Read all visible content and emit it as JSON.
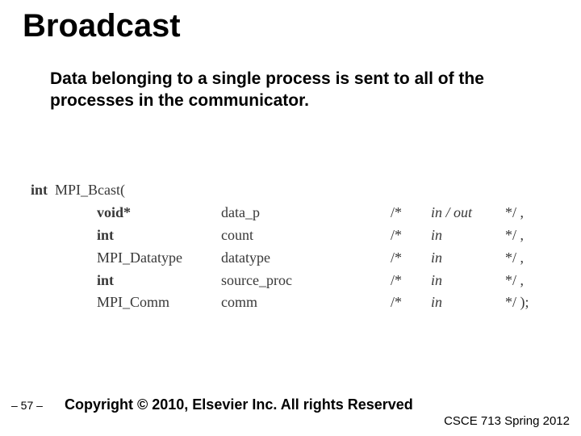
{
  "title": "Broadcast",
  "description": "Data belonging to a single process is sent to all of the processes in the communicator.",
  "code": {
    "ret": "int",
    "fn": "MPI_Bcast(",
    "params": [
      {
        "type": "void*",
        "type_bold": true,
        "name": "data_p",
        "dir": "in / out",
        "end": "*/ ,"
      },
      {
        "type": "int",
        "type_bold": true,
        "name": "count",
        "dir": "in",
        "end": "*/ ,"
      },
      {
        "type": "MPI_Datatype",
        "type_bold": false,
        "name": "datatype",
        "dir": "in",
        "end": "*/ ,"
      },
      {
        "type": "int",
        "type_bold": true,
        "name": "source_proc",
        "dir": "in",
        "end": "*/ ,"
      },
      {
        "type": "MPI_Comm",
        "type_bold": false,
        "name": "comm",
        "dir": "in",
        "end": "*/ );"
      }
    ],
    "comment_open": "/*"
  },
  "footer": {
    "page": "– 57 –",
    "copyright": "Copyright © 2010, Elsevier Inc. All rights Reserved",
    "course": "CSCE 713 Spring 2012"
  }
}
